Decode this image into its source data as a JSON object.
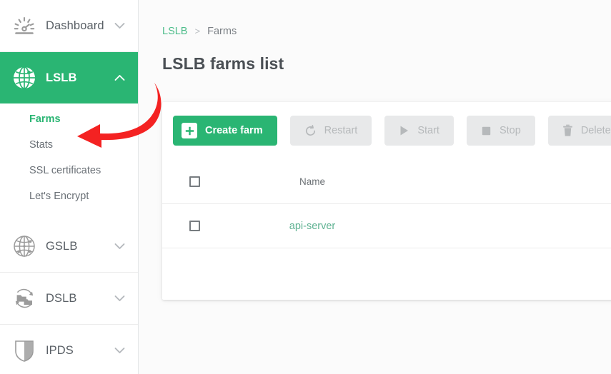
{
  "colors": {
    "accent_green": "#2ab573",
    "link_green": "#4dbd8a",
    "row_link_green": "#5fb292",
    "sidebar_text": "#5a6066",
    "disabled_btn_bg": "#e8e9ea",
    "disabled_btn_text": "#b6b9bb",
    "annotation_red": "#f42222"
  },
  "sidebar": {
    "groups": [
      {
        "label": "Dashboard",
        "icon": "speedometer-icon",
        "chevron": "chevron-down-icon",
        "active": false,
        "children": []
      },
      {
        "label": "LSLB",
        "icon": "globe-icon",
        "chevron": "chevron-up-icon",
        "active": true,
        "children": [
          {
            "label": "Farms",
            "selected": true
          },
          {
            "label": "Stats",
            "selected": false
          },
          {
            "label": "SSL certificates",
            "selected": false
          },
          {
            "label": "Let's Encrypt",
            "selected": false
          }
        ]
      },
      {
        "label": "GSLB",
        "icon": "globe-outline-icon",
        "chevron": "chevron-down-icon",
        "active": false,
        "children": []
      },
      {
        "label": "DSLB",
        "icon": "sync-servers-icon",
        "chevron": "chevron-down-icon",
        "active": false,
        "children": []
      },
      {
        "label": "IPDS",
        "icon": "shield-icon",
        "chevron": "chevron-down-icon",
        "active": false,
        "children": []
      }
    ]
  },
  "breadcrumb": {
    "root": "LSLB",
    "separator": ">",
    "current": "Farms"
  },
  "page": {
    "title": "LSLB farms list"
  },
  "toolbar": {
    "buttons": [
      {
        "label": "Create farm",
        "icon": "plus-icon",
        "style": "primary",
        "enabled": true
      },
      {
        "label": "Restart",
        "icon": "restart-icon",
        "style": "ghost",
        "enabled": false
      },
      {
        "label": "Start",
        "icon": "play-icon",
        "style": "ghost",
        "enabled": false
      },
      {
        "label": "Stop",
        "icon": "stop-icon",
        "style": "ghost",
        "enabled": false
      },
      {
        "label": "Delete",
        "icon": "trash-icon",
        "style": "ghost",
        "enabled": false
      }
    ]
  },
  "table": {
    "select_all_checkbox": "select-all",
    "columns": [
      "Name"
    ],
    "rows": [
      {
        "checked": false,
        "name": "api-server"
      }
    ]
  },
  "annotation": {
    "type": "curved-arrow",
    "points_to": "Farms",
    "color": "#f42222"
  }
}
